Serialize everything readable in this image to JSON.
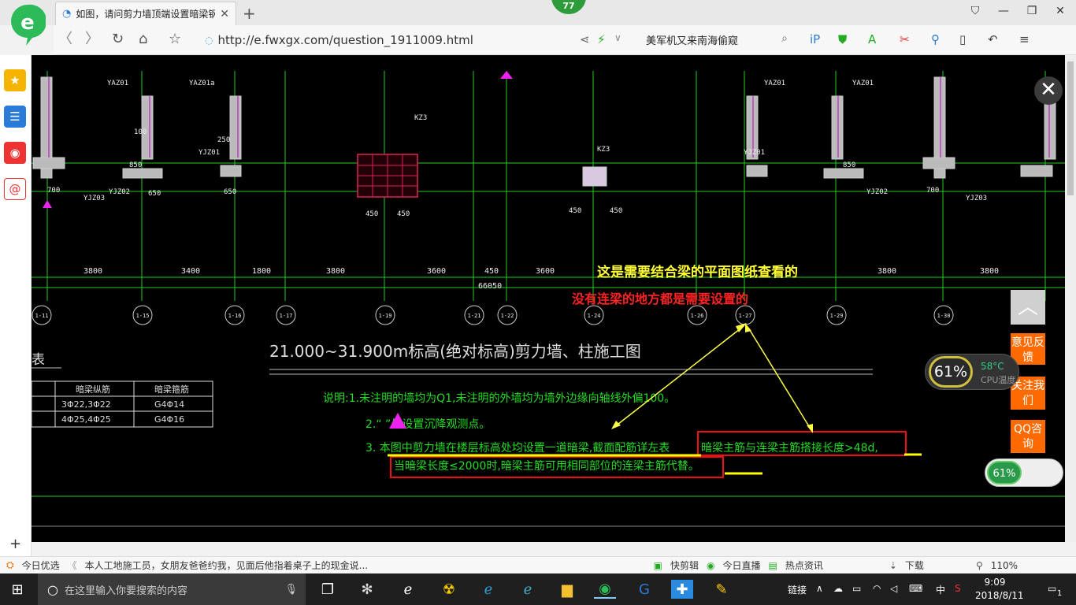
{
  "tab": {
    "title": "如图，请问剪力墙顶端设置暗梁钢"
  },
  "badge": "77",
  "address": {
    "url": "http://e.fwxgx.com/question_1911009.html"
  },
  "search": {
    "text": "美军机又来南海偷窥"
  },
  "statusbar": {
    "items": [
      "今日优选",
      "本人工地施工员，女朋友爸爸约我，见面后他指着桌子上的现金说...",
      "快剪辑",
      "今日直播",
      "热点资讯",
      "下载",
      "110%"
    ]
  },
  "taskbar": {
    "search_placeholder": "在这里输入你要搜索的内容",
    "time": "9:09",
    "date": "2018/8/11",
    "tray_link": "链接",
    "ime": "中",
    "notif_count": "1"
  },
  "side": {
    "feedback": "意见反馈",
    "follow": "关注我们",
    "qq": "QQ咨询"
  },
  "cpu": {
    "percent": "61%",
    "temp": "58°C",
    "label": "CPU温度"
  },
  "net": {
    "percent": "61%"
  },
  "cad": {
    "annot_yellow": "这是需要结合梁的平面图纸查看的",
    "annot_red": "没有连梁的地方都是需要设置的",
    "title": "21.000~31.900m标高(绝对标高)剪力墙、柱施工图",
    "note1": "说明:1.未注明的墙均为Q1,未注明的外墙均为墙外边缘向轴线外偏100。",
    "note2": "2.“    ”处设置沉降观测点。",
    "note3a": "3.  本图中剪力墙在楼层标高处均设置一道暗梁,截面配筋详左表",
    "note3b": "暗梁主筋与连梁主筋搭接长度>48d,",
    "note3c": "当暗梁长度≤2000时,暗梁主筋可用相同部位的连梁主筋代替。",
    "total_dim": "66050",
    "dims": [
      "3800",
      "3400",
      "1800",
      "3800",
      "3600",
      "450",
      "3600",
      "3800",
      "3800"
    ],
    "axes": [
      "1-11",
      "1-15",
      "1-16",
      "1-17",
      "1-19",
      "1-21",
      "1-22",
      "1-24",
      "1-26",
      "1-27",
      "1-29",
      "1-30"
    ],
    "table_header": [
      "暗梁纵筋",
      "暗梁箍筋"
    ],
    "table_rows": [
      [
        "3Φ22,3Φ22",
        "G4Φ14"
      ],
      [
        "4Φ25,4Φ25",
        "G4Φ16"
      ]
    ],
    "table_title": "表",
    "labels": [
      "YAZ01",
      "YAZ01a",
      "YAZ01",
      "YAZ01",
      "YJZ01",
      "YJZ01",
      "YJZ02",
      "YJZ02",
      "YJZ03",
      "YJZ03",
      "KZ3",
      "KZ3"
    ],
    "small_dims": [
      "450",
      "450",
      "450",
      "450",
      "700",
      "850",
      "650",
      "650",
      "850",
      "700",
      "250",
      "100"
    ]
  }
}
